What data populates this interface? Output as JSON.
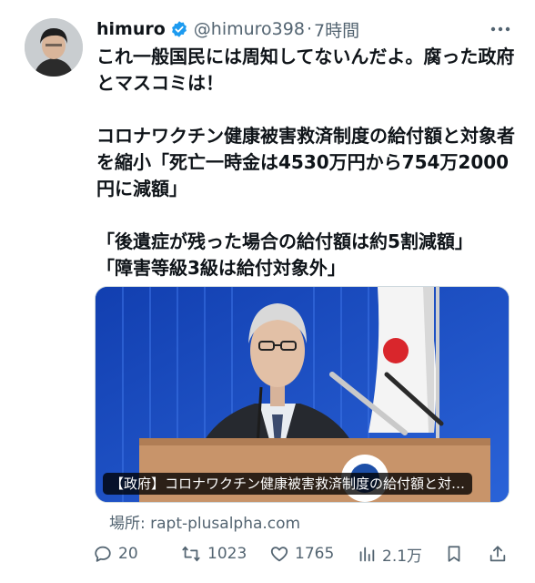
{
  "user": {
    "display_name": "himuro",
    "handle": "@himuro398",
    "separator": "·",
    "time": "7時間"
  },
  "tweet": {
    "text": "これ一般国民には周知してないんだよ。腐った政府とマスコミは！\n\nコロナワクチン健康被害救済制度の給付額と対象者を縮小「死亡一時金は4530万円から754万2000円に減額」\n\n「後遺症が残った場合の給付額は約5割減額」\n「障害等級3級は給付対象外」"
  },
  "media": {
    "caption": "【政府】コロナワクチン健康被害救済制度の給付額と対…"
  },
  "source": {
    "label": "場所: rapt-plusalpha.com"
  },
  "actions": {
    "reply_count": "20",
    "retweet_count": "1023",
    "like_count": "1765",
    "views_count": "2.1万"
  },
  "colors": {
    "text": "#0f1419",
    "secondary": "#536471",
    "verified": "#1d9bf0",
    "media_background": "#1a4fc4"
  },
  "icons": {
    "verified": "verified-badge-icon",
    "more": "more-icon",
    "reply": "reply-icon",
    "retweet": "retweet-icon",
    "like": "heart-icon",
    "views": "views-icon",
    "bookmark": "bookmark-icon",
    "share": "share-icon"
  }
}
